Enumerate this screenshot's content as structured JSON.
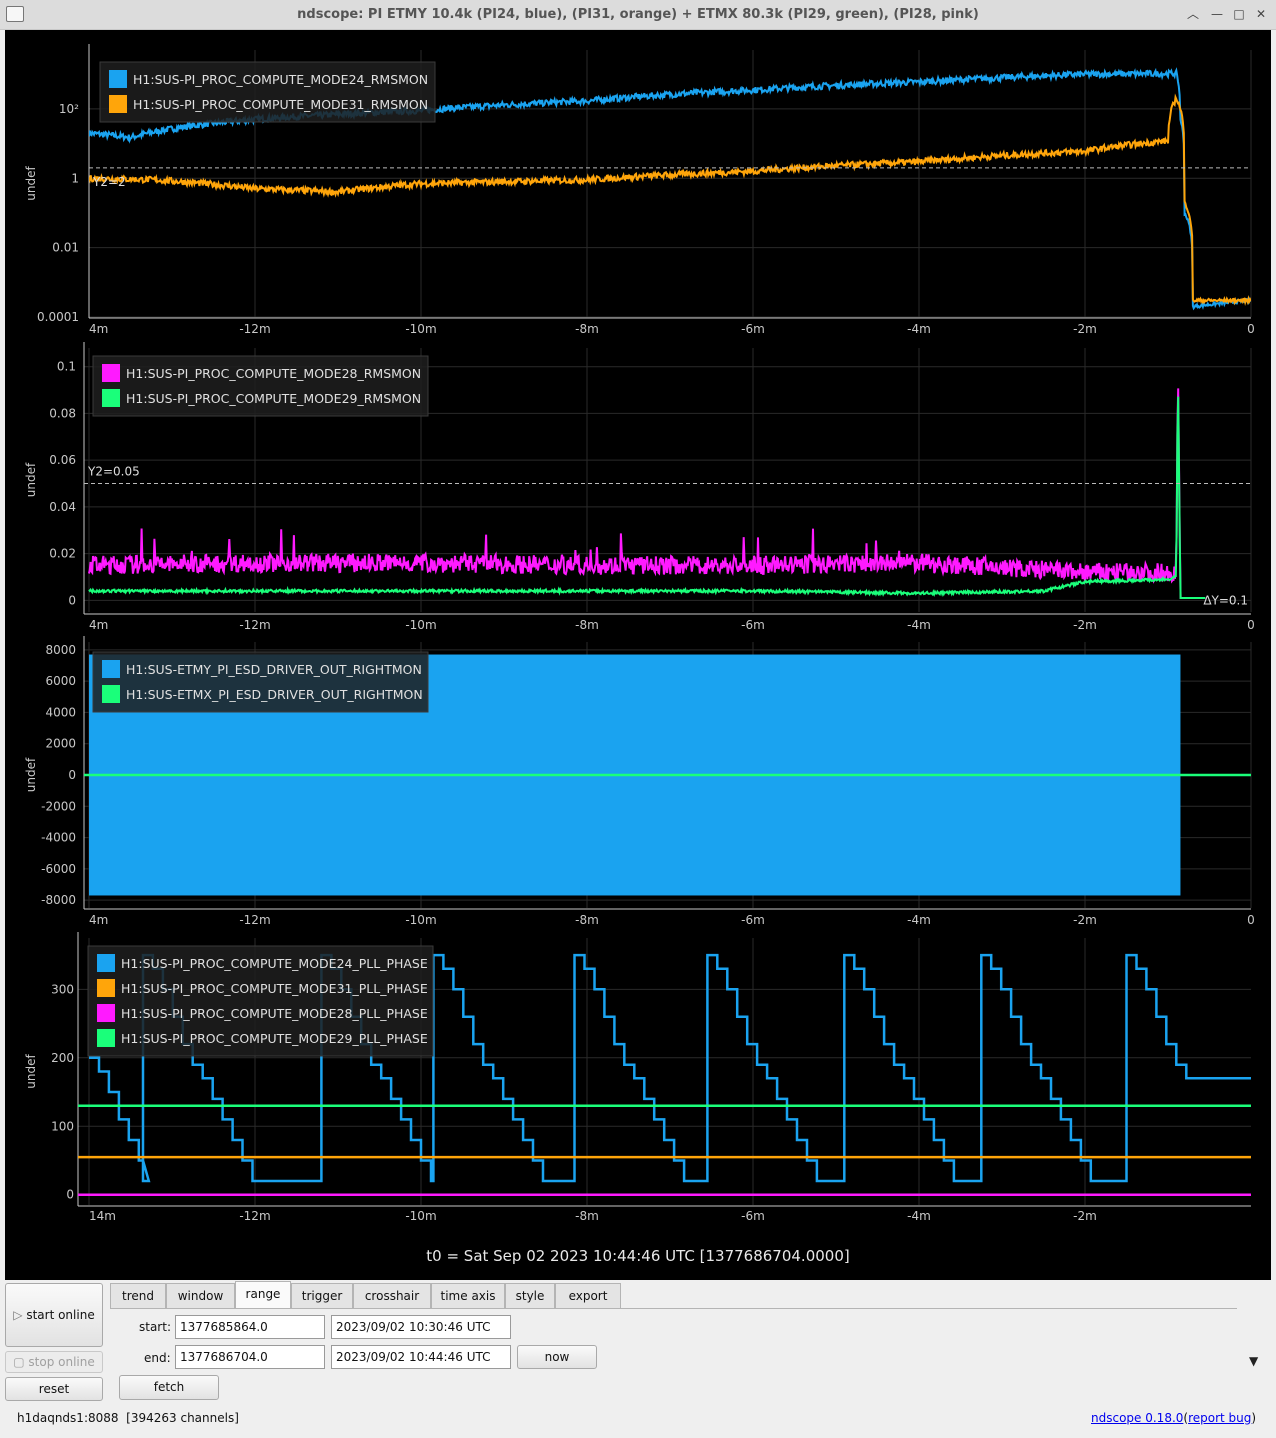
{
  "window": {
    "title": "ndscope: PI ETMY 10.4k (PI24, blue), (PI31, orange) + ETMX 80.3k (PI29, green), (PI28, pink)"
  },
  "colors": {
    "blue": "#1aa3f0",
    "orange": "#ffa50a",
    "pink": "#ff1aff",
    "green": "#1aff7a",
    "background": "#000000",
    "axis": "#c8c8c8"
  },
  "xaxis": {
    "ticks": [
      {
        "t": -14,
        "label": "4m"
      },
      {
        "t": -12,
        "label": "-12m"
      },
      {
        "t": -10,
        "label": "-10m"
      },
      {
        "t": -8,
        "label": "-8m"
      },
      {
        "t": -6,
        "label": "-6m"
      },
      {
        "t": -4,
        "label": "-4m"
      },
      {
        "t": -2,
        "label": "-2m"
      },
      {
        "t": 0,
        "label": "0"
      }
    ],
    "ticks_last": [
      {
        "t": -14,
        "label": "14m"
      },
      {
        "t": -12,
        "label": "-12m"
      },
      {
        "t": -10,
        "label": "-10m"
      },
      {
        "t": -8,
        "label": "-8m"
      },
      {
        "t": -6,
        "label": "-6m"
      },
      {
        "t": -4,
        "label": "-4m"
      },
      {
        "t": -2,
        "label": "-2m"
      }
    ]
  },
  "t0_label": "t0 = Sat Sep 02 2023 10:44:46 UTC [1377686704.0000]",
  "chart_data": [
    {
      "type": "line",
      "ylabel": "undef",
      "yscale": "log",
      "ylim": [
        0.0001,
        5000
      ],
      "yticks": [
        {
          "v": 100,
          "label": "10²"
        },
        {
          "v": 1,
          "label": "1"
        },
        {
          "v": 0.01,
          "label": "0.01"
        },
        {
          "v": 0.0001,
          "label": "0.0001"
        }
      ],
      "cursor": {
        "value": 2,
        "label": "Y2=2"
      },
      "series": [
        {
          "name": "H1:SUS-PI_PROC_COMPUTE_MODE24_RMSMON",
          "color": "blue",
          "points": [
            [
              -14,
              20
            ],
            [
              -13.5,
              15
            ],
            [
              -12,
              50
            ],
            [
              -10,
              90
            ],
            [
              -8,
              170
            ],
            [
              -6,
              350
            ],
            [
              -4,
              600
            ],
            [
              -2,
              1000
            ],
            [
              -0.9,
              1050
            ],
            [
              -0.85,
              50
            ],
            [
              -0.8,
              0.1
            ],
            [
              -0.7,
              0.0002
            ],
            [
              0,
              0.0003
            ]
          ]
        },
        {
          "name": "H1:SUS-PI_PROC_COMPUTE_MODE31_RMSMON",
          "color": "orange",
          "points": [
            [
              -14,
              1
            ],
            [
              -13.2,
              0.9
            ],
            [
              -12,
              0.5
            ],
            [
              -11,
              0.4
            ],
            [
              -10,
              0.7
            ],
            [
              -8,
              0.9
            ],
            [
              -6,
              1.6
            ],
            [
              -4,
              3
            ],
            [
              -2,
              6
            ],
            [
              -1,
              12
            ],
            [
              -0.9,
              200
            ],
            [
              -0.8,
              0.2
            ],
            [
              -0.7,
              0.0003
            ],
            [
              0,
              0.0003
            ]
          ]
        }
      ]
    },
    {
      "type": "line",
      "ylabel": "undef",
      "ylim": [
        -0.005,
        0.108
      ],
      "yticks": [
        0.1,
        0.08,
        0.06,
        0.04,
        0.02,
        0
      ],
      "cursor": {
        "value": 0.05,
        "label": "Y2=0.05"
      },
      "delta_label": "ΔY=0.1",
      "series": [
        {
          "name": "H1:SUS-PI_PROC_COMPUTE_MODE28_RMSMON",
          "color": "pink",
          "points": [
            [
              -14,
              0.015
            ],
            [
              -12,
              0.016
            ],
            [
              -10,
              0.016
            ],
            [
              -8,
              0.015
            ],
            [
              -6,
              0.015
            ],
            [
              -4,
              0.016
            ],
            [
              -2,
              0.012
            ],
            [
              -0.9,
              0.012
            ],
            [
              -0.88,
              0.102
            ],
            [
              -0.85,
              0.001
            ],
            [
              -0.55,
              0.001
            ]
          ]
        },
        {
          "name": "H1:SUS-PI_PROC_COMPUTE_MODE29_RMSMON",
          "color": "green",
          "points": [
            [
              -14,
              0.004
            ],
            [
              -12,
              0.004
            ],
            [
              -10,
              0.004
            ],
            [
              -8,
              0.004
            ],
            [
              -6,
              0.004
            ],
            [
              -4,
              0.003
            ],
            [
              -2.5,
              0.004
            ],
            [
              -2,
              0.008
            ],
            [
              -1,
              0.009
            ],
            [
              -0.9,
              0.01
            ],
            [
              -0.88,
              0.098
            ],
            [
              -0.85,
              0.001
            ],
            [
              -0.55,
              0.001
            ]
          ]
        }
      ]
    },
    {
      "type": "area",
      "ylabel": "undef",
      "ylim": [
        -8500,
        8500
      ],
      "yticks": [
        8000,
        6000,
        4000,
        2000,
        0,
        -2000,
        -4000,
        -6000,
        -8000
      ],
      "series": [
        {
          "name": "H1:SUS-ETMY_PI_ESD_DRIVER_OUT_RIGHTMON",
          "color": "blue",
          "band": [
            -7700,
            7700
          ],
          "x_range": [
            -14,
            -0.85
          ]
        },
        {
          "name": "H1:SUS-ETMX_PI_ESD_DRIVER_OUT_RIGHTMON",
          "color": "green",
          "value": 0
        }
      ]
    },
    {
      "type": "line",
      "ylabel": "undef",
      "ylim": [
        -15,
        375
      ],
      "yticks": [
        300,
        200,
        100,
        0
      ],
      "series": [
        {
          "name": "H1:SUS-PI_PROC_COMPUTE_MODE24_PLL_PHASE",
          "color": "blue",
          "step_cycles": [
            -14.0,
            -13.35,
            -11.2,
            -9.85,
            -8.15,
            -6.55,
            -4.9,
            -3.25,
            -1.5
          ],
          "final_value": 170
        },
        {
          "name": "H1:SUS-PI_PROC_COMPUTE_MODE31_PLL_PHASE",
          "color": "orange",
          "value": 55
        },
        {
          "name": "H1:SUS-PI_PROC_COMPUTE_MODE28_PLL_PHASE",
          "color": "pink",
          "value": 0
        },
        {
          "name": "H1:SUS-PI_PROC_COMPUTE_MODE29_PLL_PHASE",
          "color": "green",
          "value": 130
        }
      ]
    }
  ],
  "controls": {
    "start_online": "start online",
    "stop_online": "stop online",
    "reset": "reset",
    "tabs": [
      "trend",
      "window",
      "range",
      "trigger",
      "crosshair",
      "time axis",
      "style",
      "export"
    ],
    "active_tab": "range",
    "start_label": "start:",
    "start_gps": "1377685864.0",
    "start_utc": "2023/09/02 10:30:46 UTC",
    "end_label": "end:",
    "end_gps": "1377686704.0",
    "end_utc": "2023/09/02 10:44:46 UTC",
    "now": "now",
    "fetch": "fetch"
  },
  "status": {
    "server": "h1daqnds1:8088",
    "channels": "[394263 channels]",
    "version_link": "ndscope 0.18.0",
    "paren_open": "(",
    "bug_link": "report bug",
    "paren_close": ")"
  }
}
